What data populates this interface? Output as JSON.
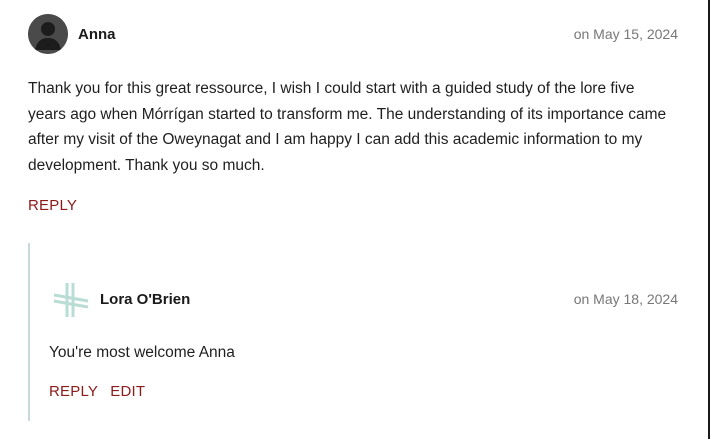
{
  "comment": {
    "author": "Anna",
    "date": "on May 15, 2024",
    "text": "Thank you for this great ressource, I wish I could start with a guided study of the lore five years ago when Mórrígan started to transform me. The understanding of its importance came after my visit of the Oweynagat and I am happy I can add this academic information to my development. Thank you so much.",
    "reply_label": "REPLY"
  },
  "reply": {
    "author": "Lora O'Brien",
    "date": "on May 18, 2024",
    "text": "You're most welcome Anna",
    "reply_label": "REPLY",
    "edit_label": "EDIT"
  },
  "colors": {
    "link": "#8b1a1a",
    "date": "#777777",
    "thread_line": "#c9d7df",
    "logo": "#b9ddd5"
  },
  "icons": {
    "avatar": "default-user-avatar",
    "reply_avatar": "site-logo-icon"
  }
}
